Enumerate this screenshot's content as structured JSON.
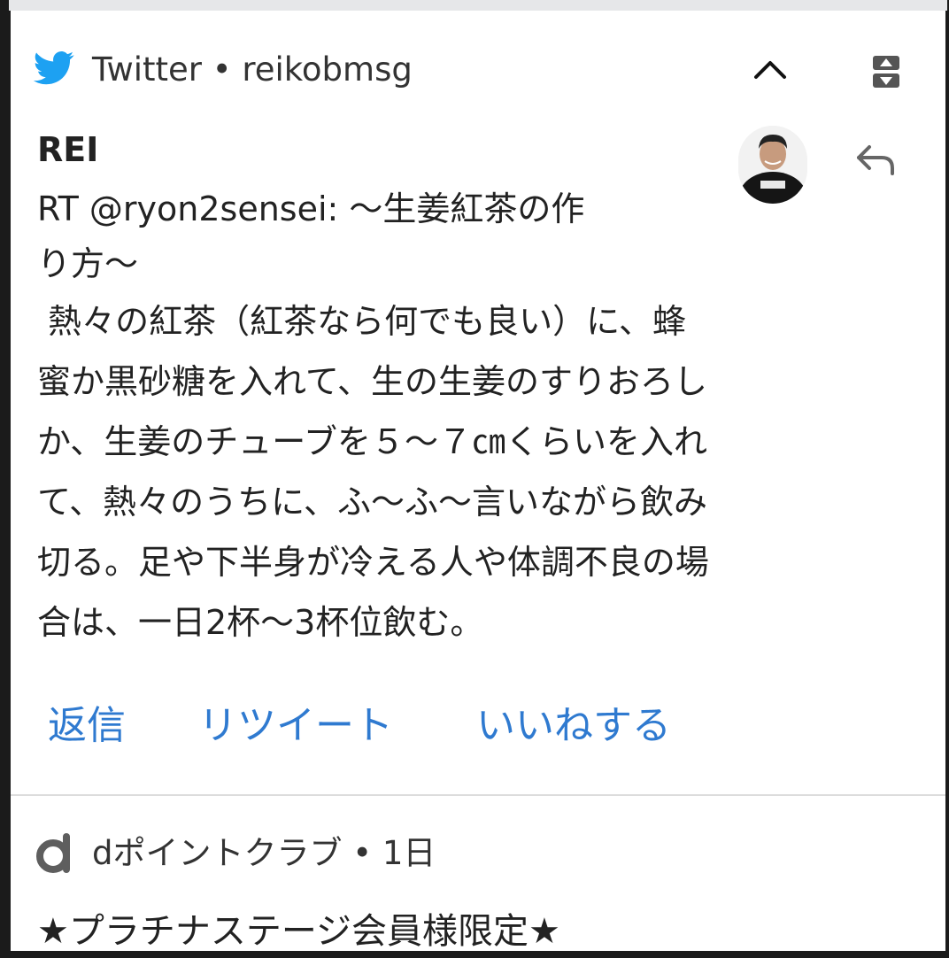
{
  "notification_1": {
    "app_name": "Twitter",
    "separator": "•",
    "account": "reikobmsg",
    "header_text": "Twitter • reikobmsg",
    "sender": "REI",
    "body_line_1": "RT @ryon2sensei: 〜生姜紅茶の作\nり方〜",
    "body_line_2": " 熱々の紅茶（紅茶なら何でも良い）に、蜂\n蜜か黒砂糖を入れて、生の生姜のすりおろし\nか、生姜のチューブを５〜７㎝くらいを入れ\nて、熱々のうちに、ふ〜ふ〜言いながら飲み\n切る。足や下半身が冷える人や体調不良の場\n合は、一日2杯〜3杯位飲む。",
    "actions": {
      "reply": "返信",
      "retweet": "リツイート",
      "like": "いいねする"
    },
    "icons": {
      "app": "twitter-bird-icon",
      "collapse": "chevron-up-icon",
      "expand": "expand-collapse-icon",
      "reply": "reply-arrow-icon"
    },
    "colors": {
      "twitter_blue": "#1da1f2",
      "action_blue": "#2f7ad0"
    }
  },
  "notification_2": {
    "header_text": "dポイントクラブ • 1日",
    "title": "★プラチナステージ会員様限定★",
    "icon": "d-point-icon"
  }
}
